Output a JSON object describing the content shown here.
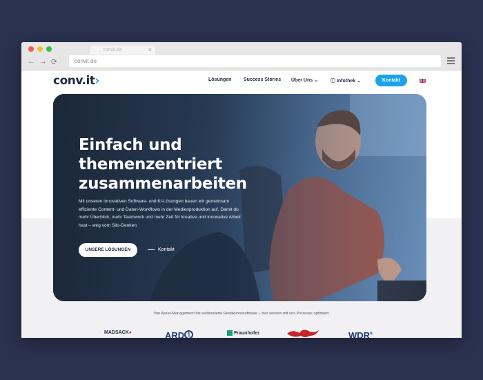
{
  "browser": {
    "tab_title": "convit.de",
    "tab_close": "×",
    "address": "convit.de",
    "back_icon": "←",
    "forward_icon": "→",
    "reload_icon": "⟳",
    "dots": [
      "#ee5f57",
      "#f5bd32",
      "#35c241"
    ]
  },
  "header": {
    "logo": "conv.it",
    "logo_arrow": "›",
    "nav": [
      "Lösungen",
      "Success Stories",
      "Über Uns",
      "Infothek"
    ],
    "contact": "Kontakt"
  },
  "hero": {
    "title": "Einfach und themenzentriert zusammenarbeiten",
    "text": "Mit unseren innovativen Software- und KI-Lösungen bauen wir gemeinsam effiziente Content- und Daten-Workflows in der Medienproduktion auf. Damit du mehr Überblick, mehr Teamwork und mehr Zeit für kreative und innovative Arbeit hast – weg vom Silo-Denken.",
    "button": "UNSERE LÖSUNGEN",
    "link": "Kontakt"
  },
  "logos": {
    "caption": "Von Asset-Management bis webbasierte Redaktionssoftware – hier werden mit uns Prozesse optimiert:",
    "items": [
      "MADSACK",
      "ARD",
      "Fraunhofer",
      "WDR"
    ]
  }
}
